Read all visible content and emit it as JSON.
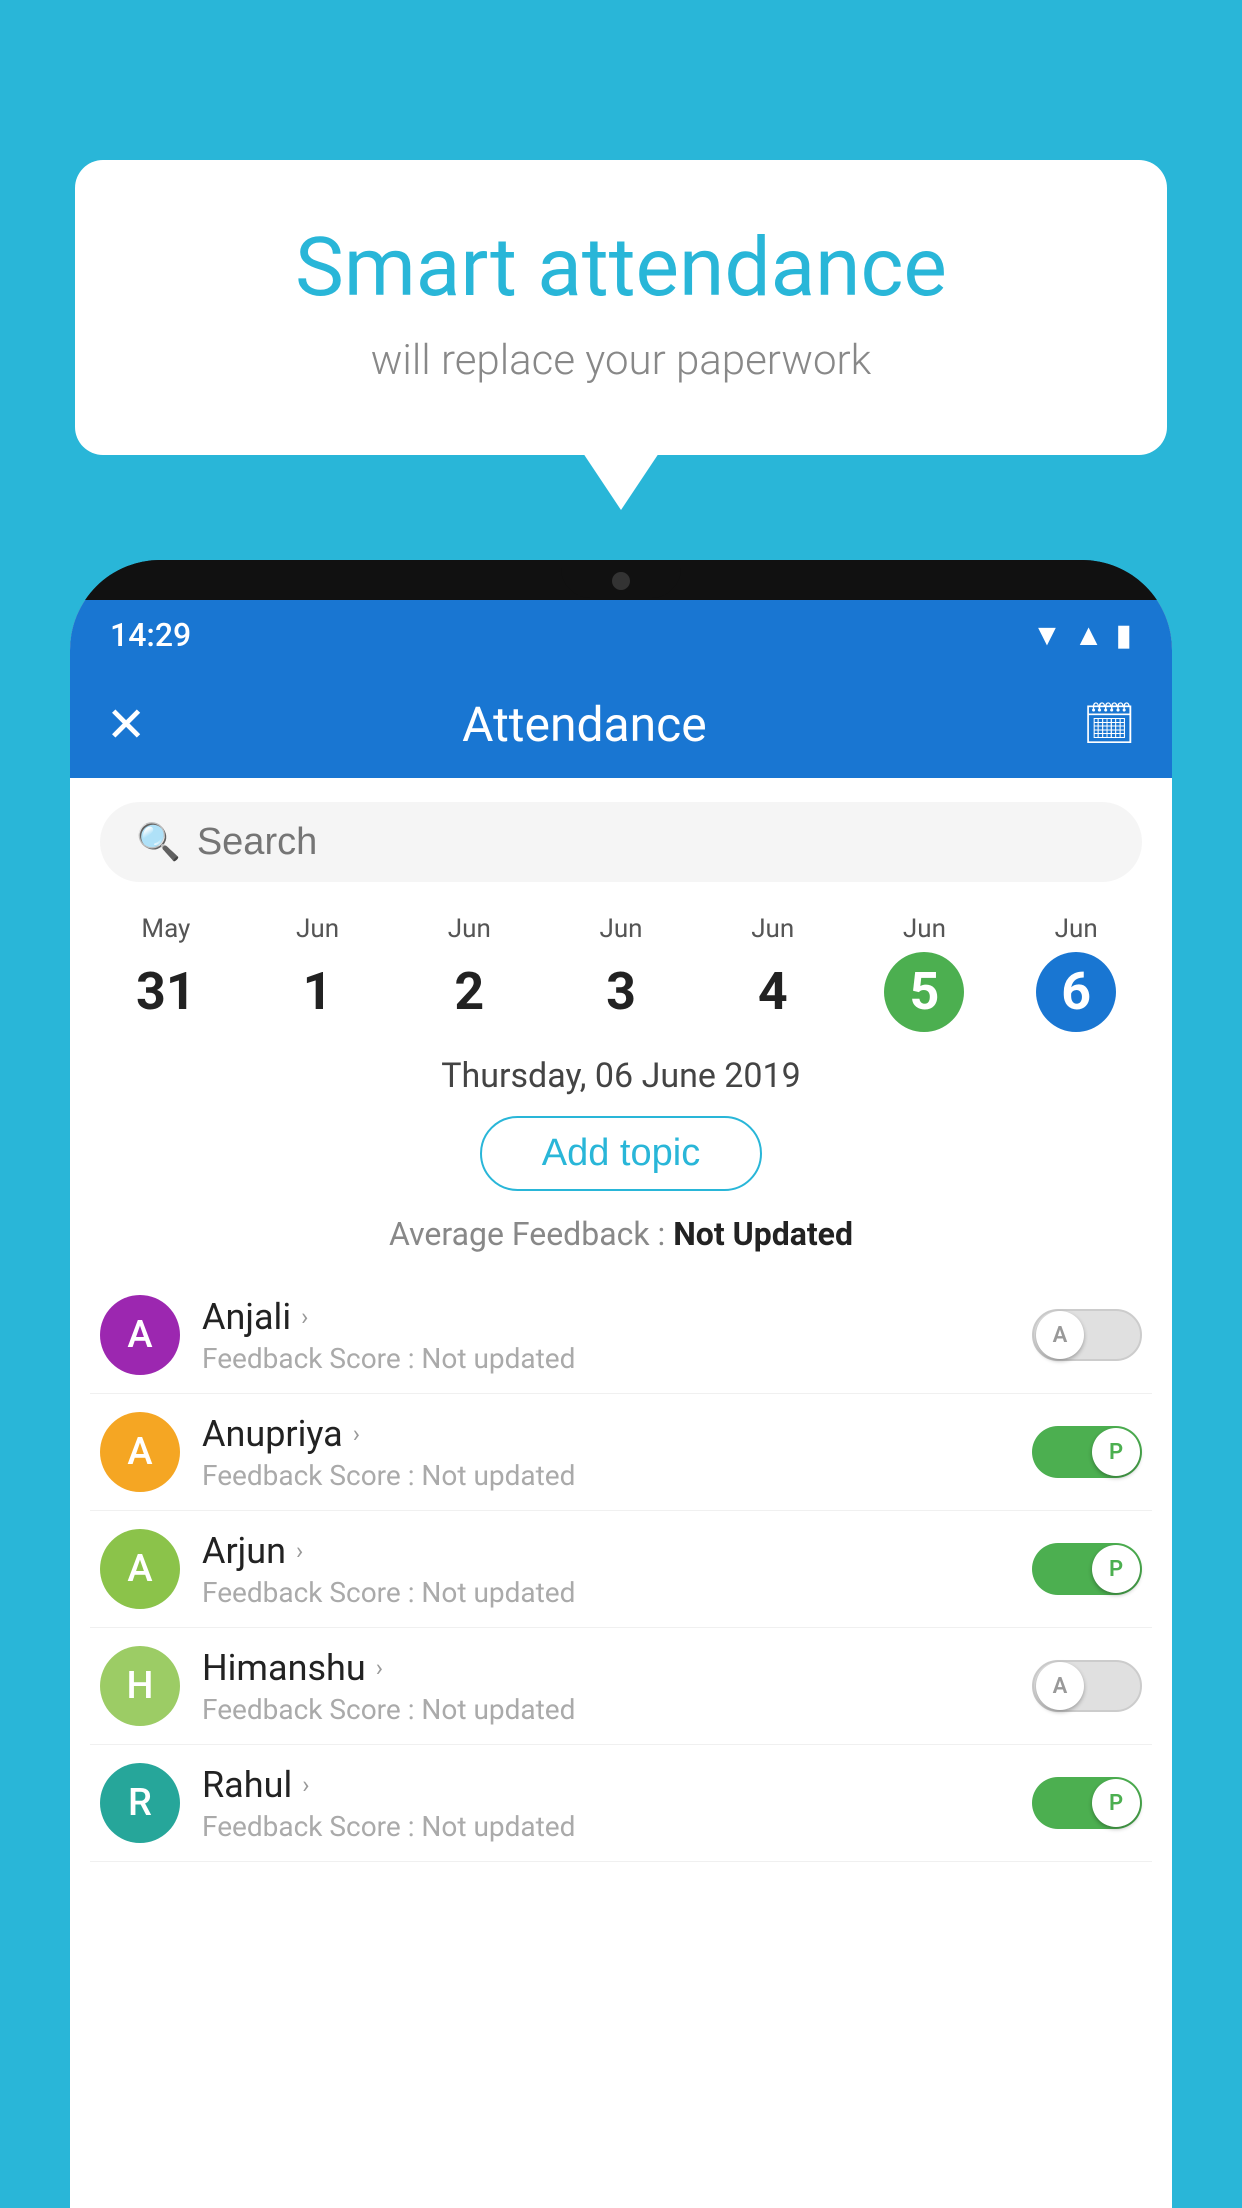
{
  "background_color": "#29b6d8",
  "speech_bubble": {
    "title": "Smart attendance",
    "subtitle": "will replace your paperwork"
  },
  "status_bar": {
    "time": "14:29",
    "wifi_icon": "▲",
    "signal_icon": "▲",
    "battery_icon": "▮"
  },
  "app_bar": {
    "close_label": "✕",
    "title": "Attendance",
    "calendar_label": "📅"
  },
  "search": {
    "placeholder": "Search"
  },
  "calendar": {
    "days": [
      {
        "month": "May",
        "date": "31",
        "style": "normal"
      },
      {
        "month": "Jun",
        "date": "1",
        "style": "normal"
      },
      {
        "month": "Jun",
        "date": "2",
        "style": "normal"
      },
      {
        "month": "Jun",
        "date": "3",
        "style": "normal"
      },
      {
        "month": "Jun",
        "date": "4",
        "style": "normal"
      },
      {
        "month": "Jun",
        "date": "5",
        "style": "today"
      },
      {
        "month": "Jun",
        "date": "6",
        "style": "selected"
      }
    ]
  },
  "date_label": "Thursday, 06 June 2019",
  "add_topic_label": "Add topic",
  "avg_feedback_label": "Average Feedback : ",
  "avg_feedback_value": "Not Updated",
  "students": [
    {
      "name": "Anjali",
      "avatar_letter": "A",
      "avatar_color": "purple",
      "feedback": "Feedback Score : Not updated",
      "toggle": "off",
      "toggle_letter": "A"
    },
    {
      "name": "Anupriya",
      "avatar_letter": "A",
      "avatar_color": "yellow",
      "feedback": "Feedback Score : Not updated",
      "toggle": "on",
      "toggle_letter": "P"
    },
    {
      "name": "Arjun",
      "avatar_letter": "A",
      "avatar_color": "green",
      "feedback": "Feedback Score : Not updated",
      "toggle": "on",
      "toggle_letter": "P"
    },
    {
      "name": "Himanshu",
      "avatar_letter": "H",
      "avatar_color": "olive",
      "feedback": "Feedback Score : Not updated",
      "toggle": "off",
      "toggle_letter": "A"
    },
    {
      "name": "Rahul",
      "avatar_letter": "R",
      "avatar_color": "teal",
      "feedback": "Feedback Score : Not updated",
      "toggle": "on",
      "toggle_letter": "P"
    }
  ]
}
